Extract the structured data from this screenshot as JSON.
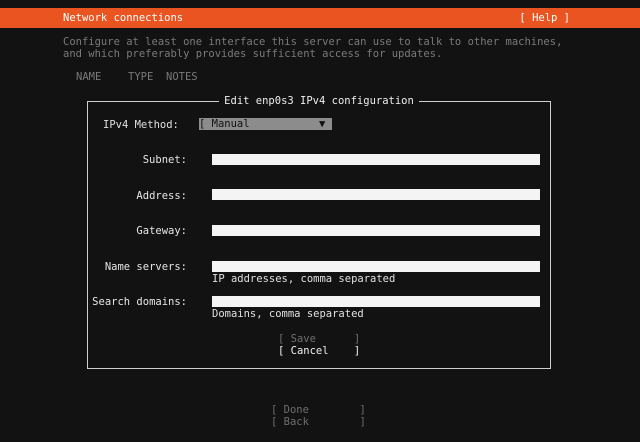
{
  "header": {
    "title": "Network connections",
    "help": "[ Help ]",
    "accent": "#E95420"
  },
  "description": [
    "Configure at least one interface this server can use to talk to other machines,",
    "and which preferably provides sufficient access for updates."
  ],
  "table_headers": {
    "name": "NAME",
    "type": "TYPE",
    "notes": "NOTES"
  },
  "dialog": {
    "title": "Edit enp0s3 IPv4 configuration",
    "method_label": "IPv4 Method:",
    "method_value": "[ Manual",
    "method_arrow": "▼ ]",
    "fields": [
      {
        "label": "Subnet:",
        "value": "",
        "hint": ""
      },
      {
        "label": "Address:",
        "value": "",
        "hint": ""
      },
      {
        "label": "Gateway:",
        "value": "",
        "hint": ""
      },
      {
        "label": "Name servers:",
        "value": "",
        "hint": "IP addresses, comma separated"
      },
      {
        "label": "Search domains:",
        "value": "",
        "hint": "Domains, comma separated"
      }
    ],
    "save": "[ Save      ]",
    "cancel": "[ Cancel    ]"
  },
  "footer": {
    "done": "[ Done        ]",
    "back": "[ Back        ]"
  }
}
